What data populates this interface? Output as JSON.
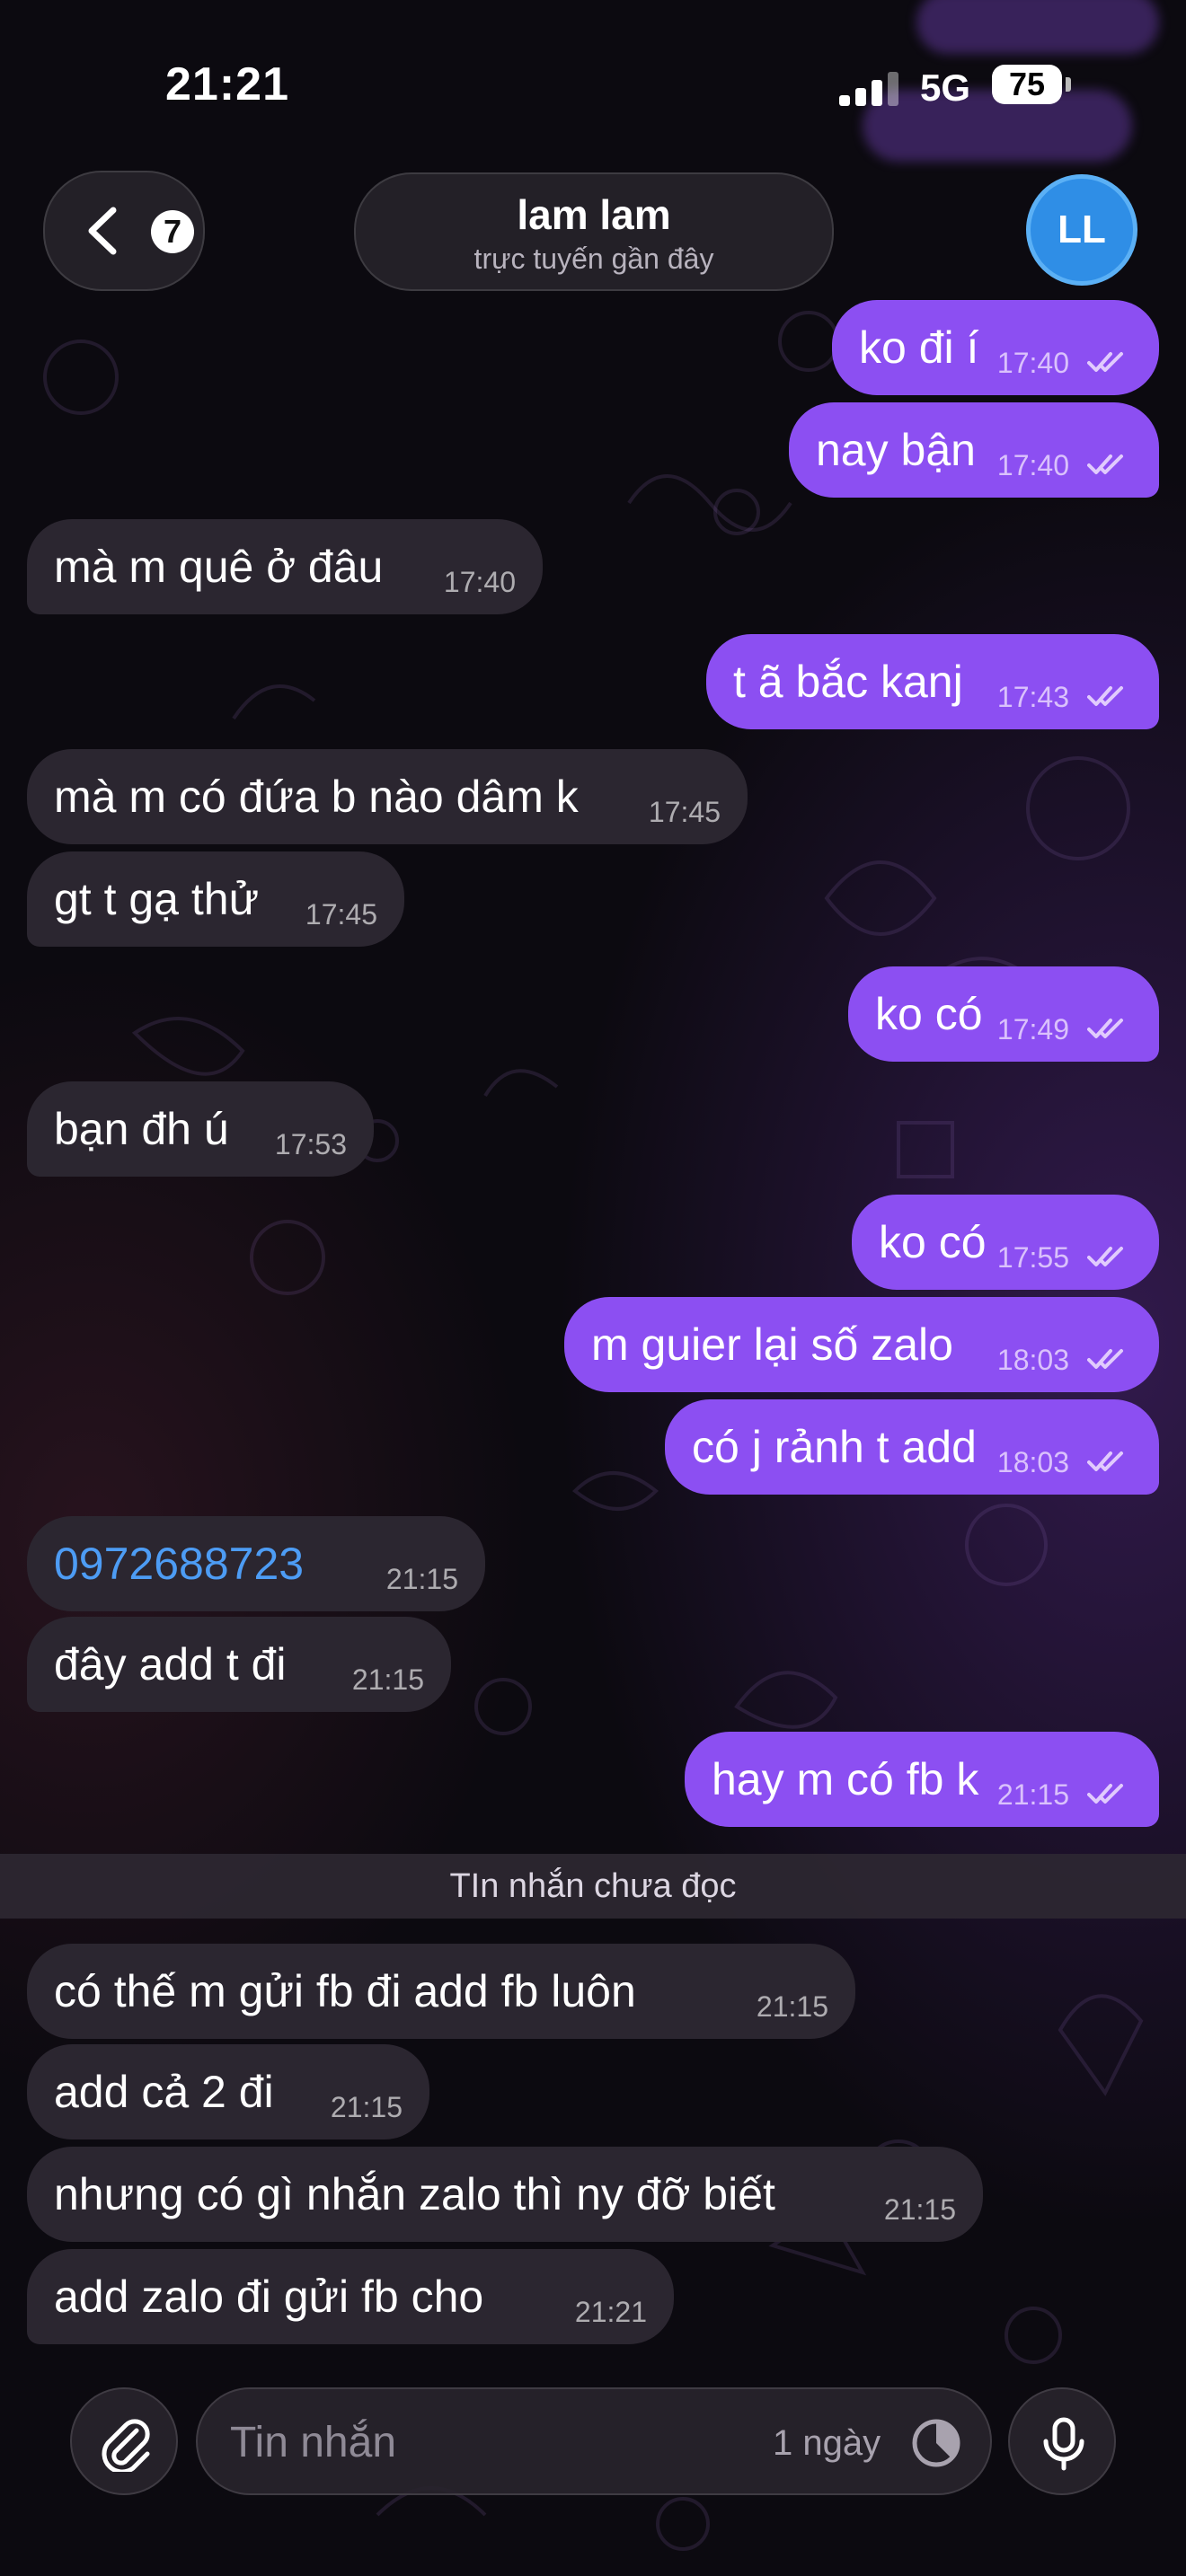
{
  "status_bar": {
    "time": "21:21",
    "network": "5G",
    "battery": "75"
  },
  "header": {
    "back_badge": "7",
    "contact_name": "lam lam",
    "contact_status": "trực tuyến gần đây",
    "avatar_initials": "LL"
  },
  "messages": [
    {
      "dir": "out",
      "text": "ko đi í",
      "time": "17:40",
      "read": true
    },
    {
      "dir": "out",
      "text": "nay bận",
      "time": "17:40",
      "read": true
    },
    {
      "dir": "in",
      "text": "mà m quê ở đâu",
      "time": "17:40"
    },
    {
      "dir": "out",
      "text": "t ã bắc kanj",
      "time": "17:43",
      "read": true
    },
    {
      "dir": "in",
      "text": "mà m có đứa b nào dâm k",
      "time": "17:45"
    },
    {
      "dir": "in",
      "text": "gt t gạ thử",
      "time": "17:45"
    },
    {
      "dir": "out",
      "text": "ko có",
      "time": "17:49",
      "read": true
    },
    {
      "dir": "in",
      "text": "bạn đh ú",
      "time": "17:53"
    },
    {
      "dir": "out",
      "text": "ko có",
      "time": "17:55",
      "read": true
    },
    {
      "dir": "out",
      "text": "m guier lại số zalo",
      "time": "18:03",
      "read": true
    },
    {
      "dir": "out",
      "text": "có j rảnh t add",
      "time": "18:03",
      "read": true
    },
    {
      "dir": "in",
      "text": "0972688723",
      "time": "21:15",
      "link": true
    },
    {
      "dir": "in",
      "text": "đây add t đi",
      "time": "21:15"
    },
    {
      "dir": "out",
      "text": "hay m có fb k",
      "time": "21:15",
      "read": true
    },
    {
      "dir": "in",
      "text": "có thế m gửi fb đi add fb luôn",
      "time": "21:15"
    },
    {
      "dir": "in",
      "text": "add cả 2 đi",
      "time": "21:15"
    },
    {
      "dir": "in",
      "text": "nhưng có gì nhắn zalo thì ny đỡ biết",
      "time": "21:15"
    },
    {
      "dir": "in",
      "text": "add zalo đi gửi fb cho",
      "time": "21:21"
    }
  ],
  "unread_divider": "TIn nhắn chưa đọc",
  "composer": {
    "placeholder": "Tin nhắn",
    "timer_label": "1 ngày"
  },
  "icons": {
    "back": "chevron-left-icon",
    "attach": "paperclip-icon",
    "timer": "timer-icon",
    "mic": "microphone-icon",
    "read": "double-check-icon"
  },
  "colors": {
    "outgoing_bubble": "#8c4ff2",
    "incoming_bubble": "#2b2630",
    "link": "#4d9cf4",
    "avatar": "#2f8ee6"
  }
}
